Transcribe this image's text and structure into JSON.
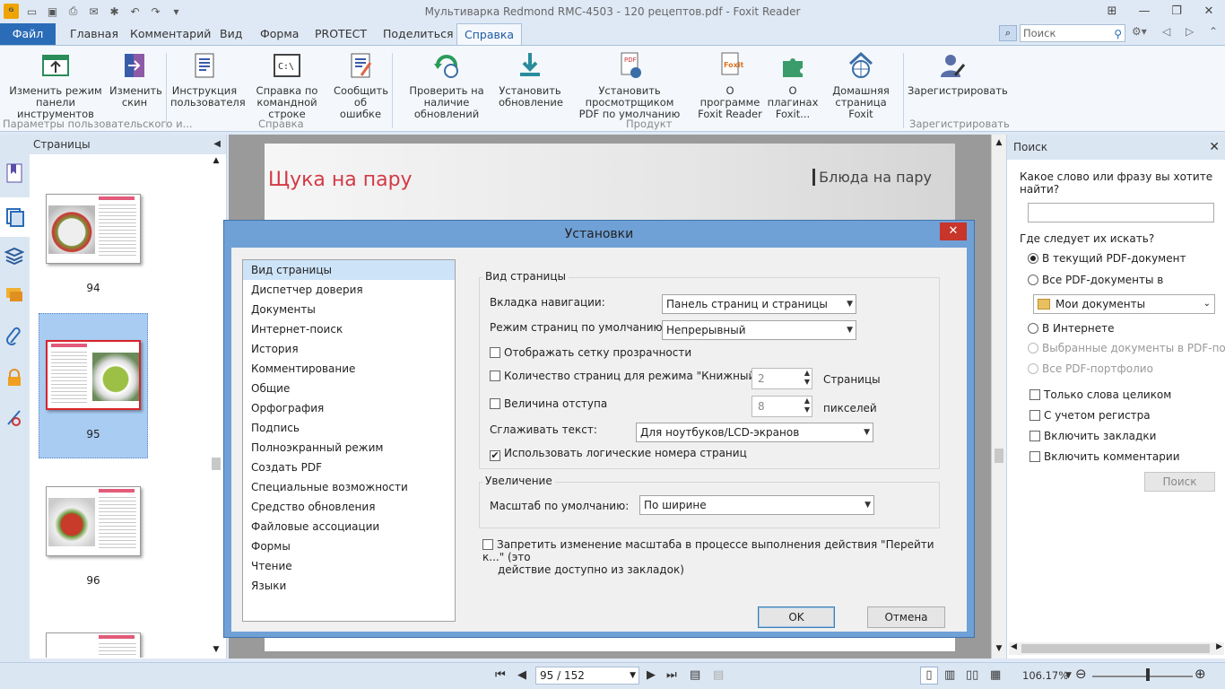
{
  "window": {
    "title": "Мультиварка Redmond RMC-4503 - 120 рецептов.pdf - Foxit Reader"
  },
  "quick_access": [
    "app-logo",
    "open-folder-icon",
    "save-icon",
    "print-icon",
    "email-icon",
    "new-icon",
    "undo-icon",
    "redo-icon",
    "customize-icon"
  ],
  "tabs": [
    {
      "label": "Файл"
    },
    {
      "label": "Главная"
    },
    {
      "label": "Комментарий"
    },
    {
      "label": "Вид"
    },
    {
      "label": "Форма"
    },
    {
      "label": "PROTECT"
    },
    {
      "label": "Поделиться"
    },
    {
      "label": "Справка"
    }
  ],
  "search": {
    "placeholder": "Поиск"
  },
  "ribbon": {
    "buttons": [
      {
        "label": "Изменить режим панели инструментов",
        "line1": "Изменить режим",
        "line2": "панели инструментов",
        "icon": "toolbar-mode-icon"
      },
      {
        "label": "Изменить скин",
        "line1": "Изменить",
        "line2": "скин",
        "icon": "skin-icon"
      },
      {
        "label": "Инструкция пользователя",
        "line1": "Инструкция",
        "line2": "пользователя",
        "icon": "user-manual-icon"
      },
      {
        "label": "Справка по командной строке",
        "line1": "Справка по",
        "line2": "командной строке",
        "icon": "command-line-icon"
      },
      {
        "label": "Сообщить об ошибке",
        "line1": "Сообщить",
        "line2": "об ошибке",
        "icon": "report-bug-icon"
      },
      {
        "label": "Проверить на наличие обновлений",
        "line1": "Проверить на",
        "line2": "наличие обновлений",
        "icon": "check-updates-icon"
      },
      {
        "label": "Установить обновление",
        "line1": "Установить",
        "line2": "обновление",
        "icon": "install-update-icon"
      },
      {
        "label": "Установить просмотрщиком PDF по умолчанию",
        "line1": "Установить просмотрщиком",
        "line2": "PDF по умолчанию",
        "icon": "default-viewer-icon"
      },
      {
        "label": "О программе Foxit Reader",
        "line1": "О программе",
        "line2": "Foxit Reader",
        "icon": "about-icon"
      },
      {
        "label": "О плагинах Foxit...",
        "line1": "О плагинах",
        "line2": "Foxit...",
        "icon": "plugin-icon"
      },
      {
        "label": "Домашняя страница Foxit",
        "line1": "Домашняя",
        "line2": "страница Foxit",
        "icon": "homepage-icon"
      },
      {
        "label": "Зарегистрировать",
        "line1": "Зарегистрировать",
        "line2": "",
        "icon": "register-icon"
      }
    ],
    "groups": [
      "Параметры пользовательского и...",
      "Справка",
      "Продукт",
      "Зарегистрировать"
    ]
  },
  "pages_panel": {
    "title": "Страницы",
    "thumbnails": [
      {
        "label": "94"
      },
      {
        "label": "95"
      },
      {
        "label": "96"
      }
    ]
  },
  "document": {
    "heading_left": "Щука на пару",
    "heading_right": "Блюда на пару"
  },
  "search_panel": {
    "title": "Поиск",
    "question": "Какое слово или фразу вы хотите найти?",
    "where": "Где следует их искать?",
    "options": [
      {
        "label": "В текущий PDF-документ",
        "checked": true,
        "disabled": false
      },
      {
        "label": "Все PDF-документы в",
        "checked": false,
        "disabled": false
      },
      {
        "label": "В Интернете",
        "checked": false,
        "disabled": false
      },
      {
        "label": "Выбранные документы в PDF-портф",
        "checked": false,
        "disabled": true
      },
      {
        "label": "Все PDF-портфолио",
        "checked": false,
        "disabled": true
      }
    ],
    "folder": "Мои документы",
    "checkboxes": [
      {
        "label": "Только слова целиком"
      },
      {
        "label": "С учетом регистра"
      },
      {
        "label": "Включить закладки"
      },
      {
        "label": "Включить комментарии"
      }
    ],
    "button": "Поиск"
  },
  "statusbar": {
    "page": "95 / 152",
    "zoom": "106.17%"
  },
  "dialog": {
    "title": "Установки",
    "categories": [
      "Вид страницы",
      "Диспетчер доверия",
      "Документы",
      "Интернет-поиск",
      "История",
      "Комментирование",
      "Общие",
      "Орфография",
      "Подпись",
      "Полноэкранный режим",
      "Создать PDF",
      "Специальные возможности",
      "Средство обновления",
      "Файловые ассоциации",
      "Формы",
      "Чтение",
      "Языки"
    ],
    "selected_category": "Вид страницы",
    "page_view": {
      "group_title": "Вид страницы",
      "nav_tab_label": "Вкладка навигации:",
      "nav_tab_value": "Панель страниц и страницы",
      "page_mode_label": "Режим страниц по умолчанию:",
      "page_mode_value": "Непрерывный",
      "transparency_grid": "Отображать сетку прозрачности",
      "book_pages_label": "Количество страниц для режима \"Книжный\"",
      "book_pages_value": "2",
      "book_pages_unit": "Страницы",
      "indent_label": "Величина отступа",
      "indent_value": "8",
      "indent_unit": "пикселей",
      "smooth_label": "Сглаживать текст:",
      "smooth_value": "Для ноутбуков/LCD-экранов",
      "logical_numbers": "Использовать логические номера страниц",
      "logical_numbers_checked": true
    },
    "zoom": {
      "group_title": "Увеличение",
      "default_label": "Масштаб по умолчанию:",
      "default_value": "По ширине"
    },
    "forbid_line1": "Запретить изменение масштаба в процессе выполнения действия \"Перейти к...\" (это",
    "forbid_line2": "действие доступно из закладок)",
    "ok": "OK",
    "cancel": "Отмена"
  }
}
